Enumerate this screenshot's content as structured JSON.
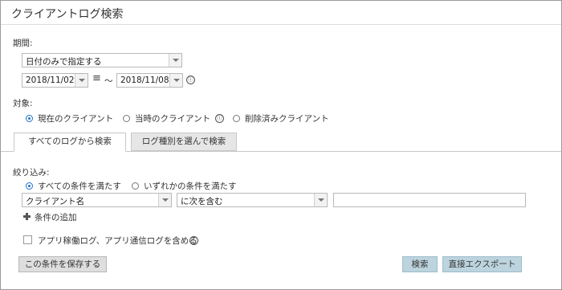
{
  "title": "クライアントログ検索",
  "period": {
    "label": "期間:",
    "mode": "日付のみで指定する",
    "from": "2018/11/02",
    "separator_symbol": "≡",
    "tilde": "〜",
    "to": "2018/11/08"
  },
  "target": {
    "label": "対象:",
    "options": [
      "現在のクライアント",
      "当時のクライアント",
      "削除済みクライアント"
    ]
  },
  "tabs": [
    "すべてのログから検索",
    "ログ種別を選んで検索"
  ],
  "filter": {
    "label": "絞り込み:",
    "match_all": "すべての条件を満たす",
    "match_any": "いずれかの条件を満たす",
    "field": "クライアント名",
    "operator": "に次を含む",
    "value": "",
    "add_condition": "条件の追加"
  },
  "include_logs": "アプリ稼働ログ、アプリ通信ログを含める",
  "buttons": {
    "save": "この条件を保存する",
    "search": "検索",
    "export": "直接エクスポート"
  },
  "icons": {
    "info": "ⓘ"
  }
}
